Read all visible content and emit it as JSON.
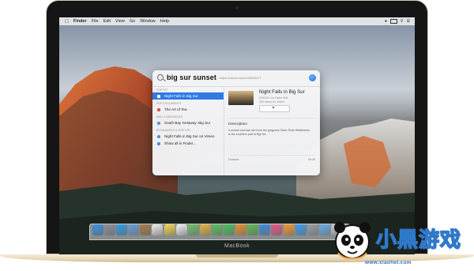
{
  "device": {
    "brand_label": "MacBook"
  },
  "menubar": {
    "items": [
      "Finder",
      "File",
      "Edit",
      "View",
      "Go",
      "Window",
      "Help"
    ],
    "status_icons": [
      "wifi-icon",
      "battery-icon",
      "search-icon",
      "list-icon"
    ]
  },
  "spotlight": {
    "query": "big sur sunset",
    "suggestion_url": "— https://vimeo.com/126839477",
    "sections": [
      {
        "label": "TOP HIT",
        "rows": [
          {
            "label": "Night Falls in Big Sur",
            "selected": true,
            "icon": "video-icon"
          }
        ]
      },
      {
        "label": "PDF DOCUMENTS",
        "rows": [
          {
            "label": "The Art of Tea",
            "selected": false,
            "icon": "pdf-icon"
          }
        ]
      },
      {
        "label": "MAIL & MESSAGES",
        "rows": [
          {
            "label": "South Bay Getaway: Big Sur",
            "selected": false,
            "icon": "mail-icon"
          }
        ]
      },
      {
        "label": "BOOKMARKS & HISTORY",
        "rows": [
          {
            "label": "Night Falls in Big Sur on Vimeo",
            "selected": false,
            "icon": "globe-icon"
          },
          {
            "label": "Show all in Finder...",
            "selected": false,
            "icon": "finder-icon"
          }
        ]
      }
    ],
    "preview": {
      "title": "Night Falls in Big Sur",
      "date": "9/26/15 • by Gabe Huff",
      "views": "200 views on Vimeo",
      "description_heading": "Description",
      "description": "A sunset and star rise from the gorgeous Silver Peak Wilderness in the southern part of Big Sur.",
      "duration_label": "Duration",
      "duration_value": "00:45"
    }
  },
  "dock": {
    "icons": [
      {
        "name": "finder-icon",
        "color": "#3b8fe3"
      },
      {
        "name": "launchpad-icon",
        "color": "#8a8f99"
      },
      {
        "name": "safari-icon",
        "color": "#2f9ce8"
      },
      {
        "name": "mail-icon",
        "color": "#6aa0d8"
      },
      {
        "name": "contacts-icon",
        "color": "#a97a45"
      },
      {
        "name": "calendar-icon",
        "color": "#f0f0f0"
      },
      {
        "name": "notes-icon",
        "color": "#f5d94e"
      },
      {
        "name": "reminders-icon",
        "color": "#f4f4f4"
      },
      {
        "name": "maps-icon",
        "color": "#6fbf6a"
      },
      {
        "name": "photos-icon",
        "color": "#e9b640"
      },
      {
        "name": "messages-icon",
        "color": "#5bc25b"
      },
      {
        "name": "facetime-icon",
        "color": "#4cbf5a"
      },
      {
        "name": "pages-icon",
        "color": "#e88f2c"
      },
      {
        "name": "numbers-icon",
        "color": "#5dbb4f"
      },
      {
        "name": "keynote-icon",
        "color": "#3c8ee0"
      },
      {
        "name": "itunes-icon",
        "color": "#e8568a"
      },
      {
        "name": "ibooks-icon",
        "color": "#f39a2e"
      },
      {
        "name": "app-store-icon",
        "color": "#3e9ef0"
      },
      {
        "name": "system-preferences-icon",
        "color": "#9b9ea3"
      },
      {
        "name": "folder-icon",
        "color": "#6ab0f0"
      },
      {
        "name": "trash-icon",
        "color": "#c9ccd0"
      }
    ]
  },
  "watermark": {
    "title": "小黑游戏",
    "url": "www.xiaoheI.com"
  }
}
